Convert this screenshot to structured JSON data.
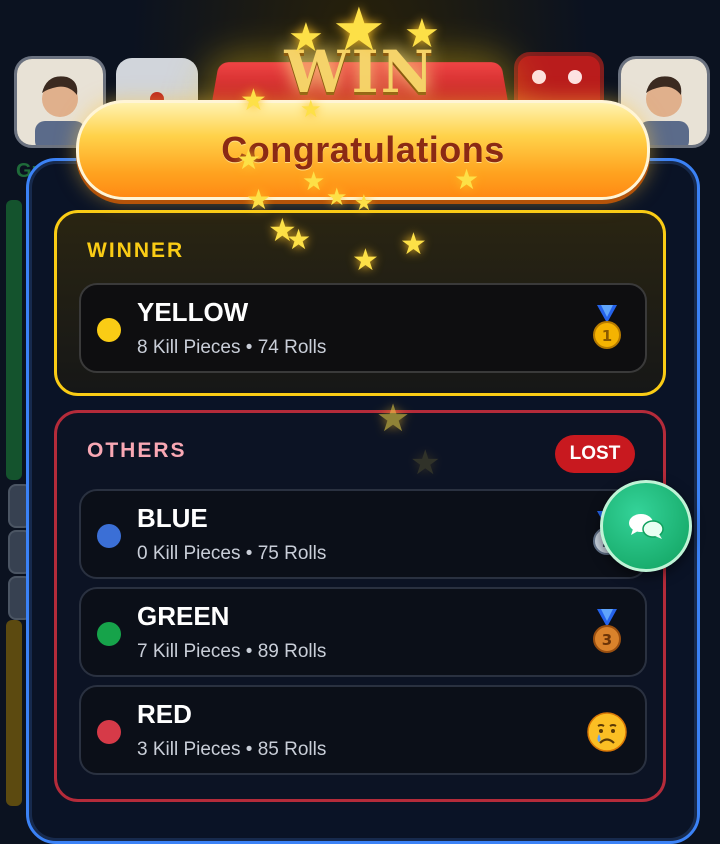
{
  "header": {
    "banner_text": "WIN",
    "title": "Congratulations"
  },
  "background": {
    "left_side_text": "Gr"
  },
  "winner_section": {
    "label": "WINNER",
    "player": {
      "name": "YELLOW",
      "stats": "8 Kill Pieces • 74 Rolls",
      "color": "#facc15",
      "badge": "gold-medal-icon"
    }
  },
  "others_section": {
    "label": "OTHERS",
    "status_badge": "LOST",
    "players": [
      {
        "name": "BLUE",
        "stats": "0 Kill Pieces • 75 Rolls",
        "color": "#3b6fd6",
        "badge": "silver-medal-icon"
      },
      {
        "name": "GREEN",
        "stats": "7 Kill Pieces • 89 Rolls",
        "color": "#16a34a",
        "badge": "bronze-medal-icon"
      },
      {
        "name": "RED",
        "stats": "3 Kill Pieces • 85 Rolls",
        "color": "#d63a48",
        "badge": "crying-face-icon"
      }
    ]
  },
  "colors": {
    "accent_gold": "#facc15",
    "panel_border": "#3b82f6",
    "others_border": "#b42b3a",
    "lost_badge": "#c8191f",
    "chat_button": "#10a05e"
  }
}
